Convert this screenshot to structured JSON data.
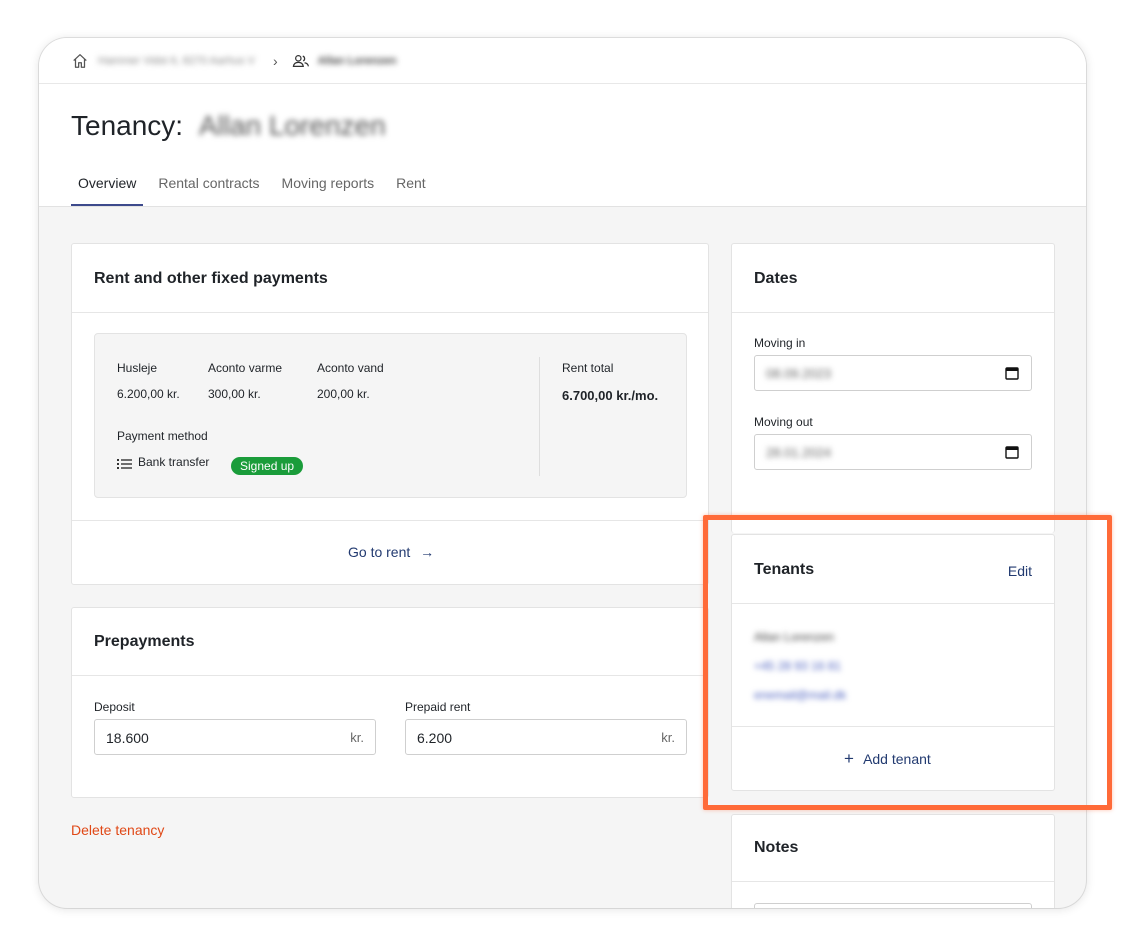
{
  "breadcrumb": {
    "address": "Hammer Vidst 6, 8270 Aarhus V",
    "tenant": "Allan Lorenzen"
  },
  "header": {
    "title_prefix": "Tenancy:",
    "title_name": "Allan Lorenzen"
  },
  "tabs": [
    {
      "label": "Overview",
      "active": true
    },
    {
      "label": "Rental contracts",
      "active": false
    },
    {
      "label": "Moving reports",
      "active": false
    },
    {
      "label": "Rent",
      "active": false
    }
  ],
  "rent_card": {
    "title": "Rent and other fixed payments",
    "items": [
      {
        "label": "Husleje",
        "value": "6.200,00 kr."
      },
      {
        "label": "Aconto varme",
        "value": "300,00 kr."
      },
      {
        "label": "Aconto vand",
        "value": "200,00 kr."
      }
    ],
    "total_label": "Rent total",
    "total_value": "6.700,00 kr./mo.",
    "payment_method_label": "Payment method",
    "payment_method": "Bank transfer",
    "payment_status": "Signed up",
    "go_to_rent": "Go to rent"
  },
  "prepayments": {
    "title": "Prepayments",
    "deposit_label": "Deposit",
    "deposit_value": "18.600",
    "deposit_unit": "kr.",
    "prepaid_label": "Prepaid rent",
    "prepaid_value": "6.200",
    "prepaid_unit": "kr."
  },
  "delete_label": "Delete tenancy",
  "dates": {
    "title": "Dates",
    "moving_in_label": "Moving in",
    "moving_in_value": "08.09.2023",
    "moving_out_label": "Moving out",
    "moving_out_value": "28.01.2024"
  },
  "tenants": {
    "title": "Tenants",
    "edit_label": "Edit",
    "name": "Allan Lorenzen",
    "phone": "+45 28 93 16 81",
    "email": "enemail@mail.dk",
    "add_label": "Add tenant"
  },
  "notes": {
    "title": "Notes"
  },
  "colors": {
    "accent": "#223a70",
    "success": "#1a9c3a",
    "danger": "#e04816",
    "highlight": "#ff6a38"
  }
}
